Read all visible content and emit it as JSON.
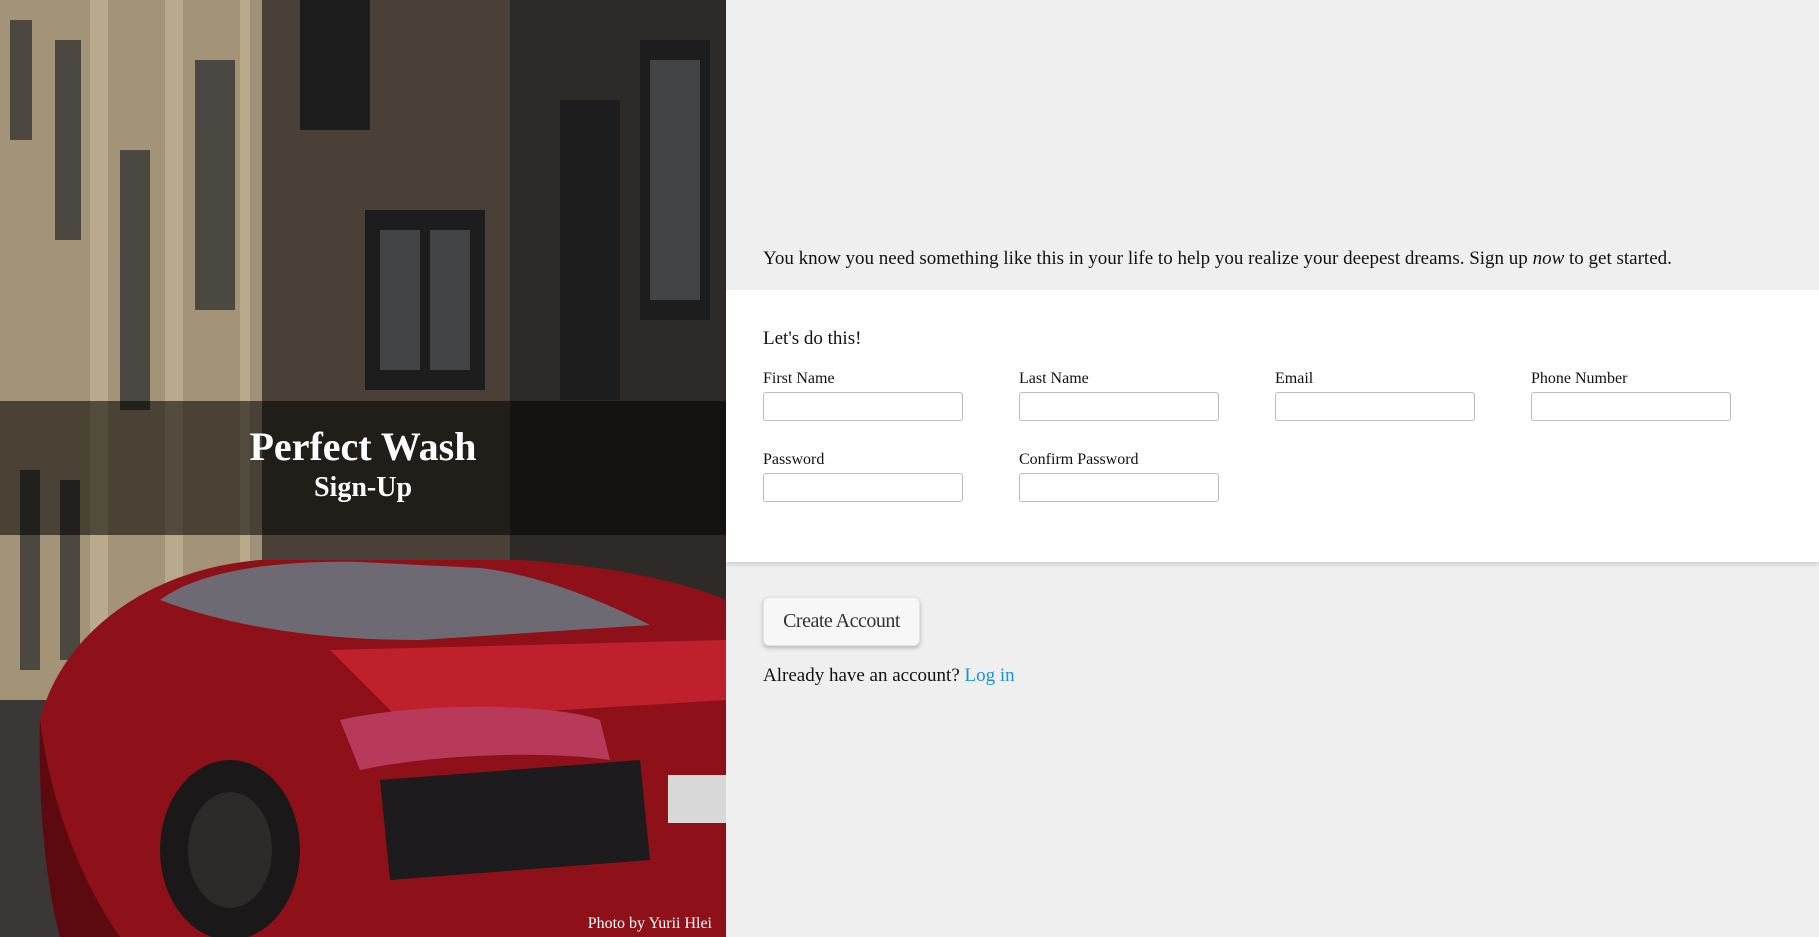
{
  "hero": {
    "brand": "Perfect Wash",
    "subtitle": "Sign-Up",
    "credit": "Photo by Yurii Hlei"
  },
  "intro": {
    "before": "You know you need something like this in your life to help you realize your deepest dreams. Sign up ",
    "emphasis": "now",
    "after": " to get started."
  },
  "form": {
    "heading": "Let's do this!",
    "fields": {
      "first_name": {
        "label": "First Name",
        "value": ""
      },
      "last_name": {
        "label": "Last Name",
        "value": ""
      },
      "email": {
        "label": "Email",
        "value": ""
      },
      "phone": {
        "label": "Phone Number",
        "value": ""
      },
      "password": {
        "label": "Password",
        "value": ""
      },
      "confirm_password": {
        "label": "Confirm Password",
        "value": ""
      }
    }
  },
  "actions": {
    "create_label": "Create Account",
    "login_prompt": "Already have an account?",
    "login_link": "Log in"
  },
  "colors": {
    "background": "#efefef",
    "card": "#ffffff",
    "link": "#1a93d6",
    "banner_overlay": "rgba(0,0,0,0.55)",
    "car_red": "#b01622"
  },
  "icons": {
    "hero_image": "building-and-red-car-photo"
  }
}
